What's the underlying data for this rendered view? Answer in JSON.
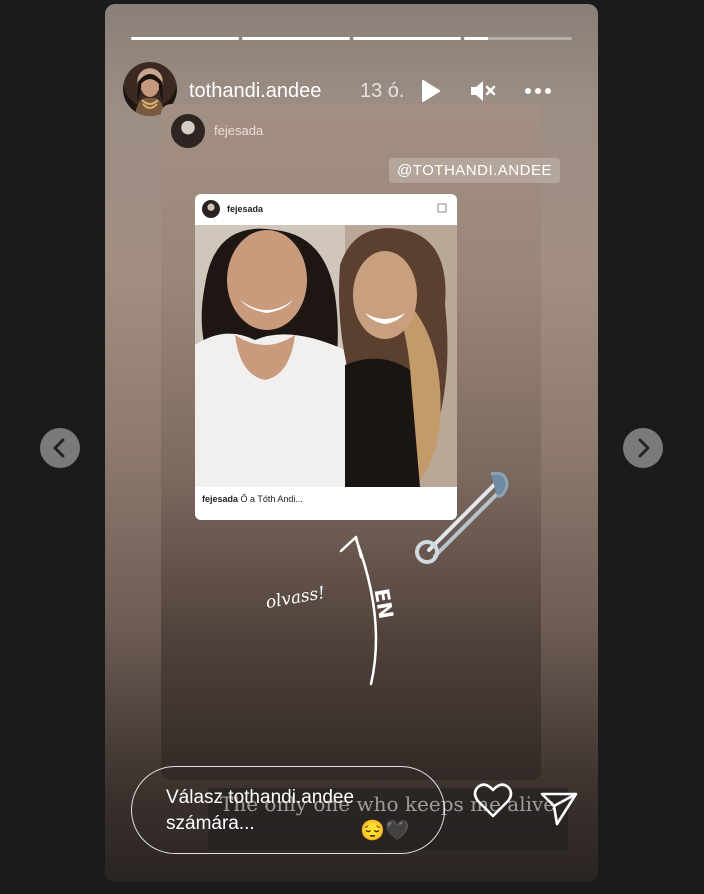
{
  "story": {
    "username": "tothandi.andee",
    "time": "13 ó.",
    "progress": [
      1,
      1,
      1,
      0.22
    ],
    "inner": {
      "source_username": "fejesada",
      "mention": "@TOTHANDI.ANDEE",
      "card": {
        "username": "fejesada",
        "caption_user": "fejesada",
        "caption_text": " Ő a Tóth Andi..."
      },
      "handwriting_left": "olvass!",
      "handwriting_right": "EN"
    },
    "music_text": "The only one who keeps me alive",
    "music_emoji": "😔🖤"
  },
  "reply": {
    "placeholder": "Válasz tothandi.andee számára..."
  },
  "icons": {
    "play": "play-icon",
    "mute": "mute-icon",
    "more": "more-icon",
    "heart": "heart-icon",
    "send": "send-icon",
    "prev": "chevron-left-icon",
    "next": "chevron-right-icon"
  }
}
